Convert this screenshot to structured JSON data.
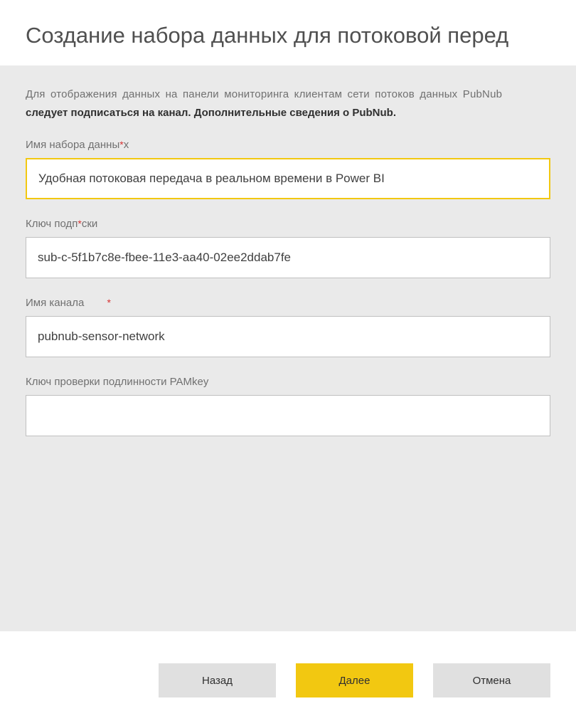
{
  "header": {
    "title": "Создание набора данных для потоковой перед"
  },
  "description": {
    "line1": "Для отображения данных на панели мониторинга клиентам сети потоков данных PubNub",
    "line2": "следует подписаться на канал. Дополнительные сведения о PubNub."
  },
  "form": {
    "dataset_name": {
      "label": "Имя набора данны",
      "required": "*",
      "value": "Удобная потоковая передача в реальном времени в Power BI"
    },
    "subscribe_key": {
      "label": "Ключ подп",
      "required": "*",
      "label_suffix": "ски",
      "value": "sub-c-5f1b7c8e-fbee-11e3-aa40-02ee2ddab7fe"
    },
    "channel_name": {
      "label": "Имя канала",
      "required": "*",
      "value": "pubnub-sensor-network"
    },
    "pam_key": {
      "label": "Ключ проверки подлинности PAMkey",
      "value": ""
    }
  },
  "buttons": {
    "back": "Назад",
    "next": "Далее",
    "cancel": "Отмена"
  }
}
